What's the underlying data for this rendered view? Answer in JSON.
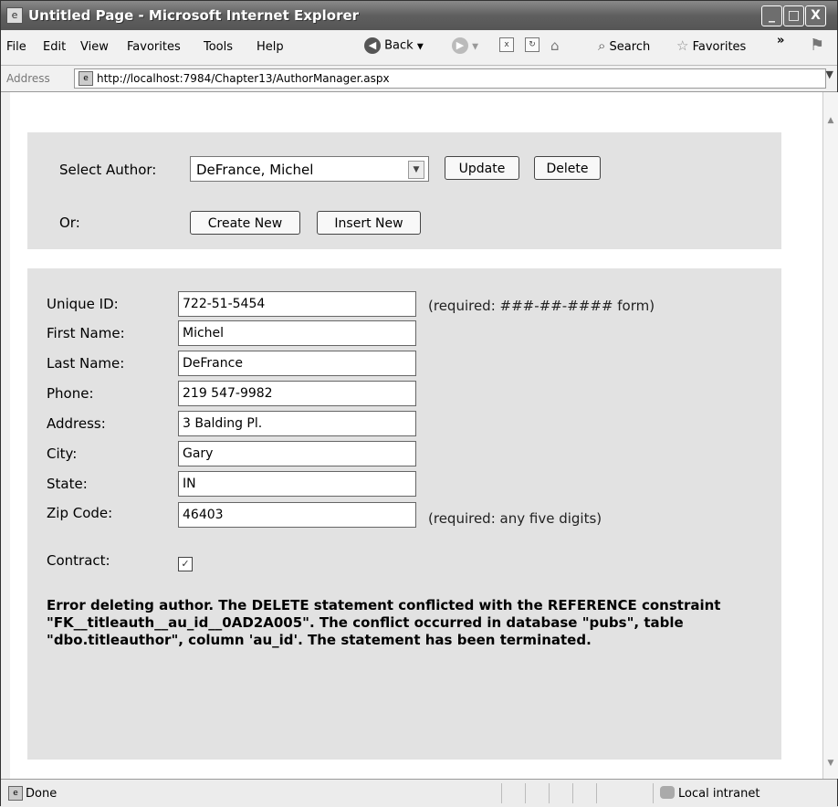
{
  "window": {
    "title": "Untitled Page - Microsoft Internet Explorer",
    "controls": [
      "_",
      "□",
      "X"
    ]
  },
  "menubar": {
    "items": [
      "File",
      "Edit",
      "View",
      "Favorites",
      "Tools",
      "Help"
    ],
    "back_label": "Back",
    "search_label": "Search",
    "favorites_label": "Favorites",
    "overflow": "»"
  },
  "address": {
    "label": "Address",
    "url": "http://localhost:7984/Chapter13/AuthorManager.aspx"
  },
  "selector": {
    "select_author_label": "Select Author:",
    "selected_author": "DeFrance, Michel",
    "update_label": "Update",
    "delete_label": "Delete",
    "or_label": "Or:",
    "create_new_label": "Create New",
    "insert_new_label": "Insert New"
  },
  "form": {
    "fields": [
      {
        "label": "Unique ID:",
        "value": "722-51-5454"
      },
      {
        "label": "First Name:",
        "value": "Michel"
      },
      {
        "label": "Last Name:",
        "value": "DeFrance"
      },
      {
        "label": "Phone:",
        "value": "219 547-9982"
      },
      {
        "label": "Address:",
        "value": "3 Balding Pl."
      },
      {
        "label": "City:",
        "value": "Gary"
      },
      {
        "label": "State:",
        "value": "IN"
      },
      {
        "label": "Zip Code:",
        "value": "46403"
      }
    ],
    "id_hint": "(required: ###-##-#### form)",
    "zip_hint": "(required: any five digits)",
    "contract_label": "Contract:",
    "contract_checked": true,
    "error_message": "Error deleting author. The DELETE statement conflicted with the REFERENCE constraint \"FK__titleauth__au_id__0AD2A005\". The conflict occurred in database \"pubs\", table \"dbo.titleauthor\", column 'au_id'. The statement has been terminated."
  },
  "status": {
    "text": "Done",
    "zone": "Local intranet"
  }
}
